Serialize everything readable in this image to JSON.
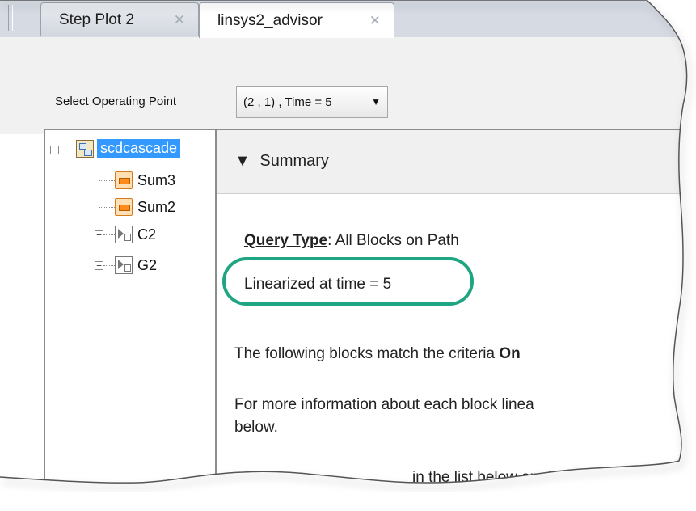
{
  "tabs": [
    {
      "label": "Step Plot 2",
      "close": "✕",
      "active": false
    },
    {
      "label": "linsys2_advisor",
      "close": "✕",
      "active": true
    }
  ],
  "operating_point": {
    "label": "Select Operating Point",
    "value": "(2 , 1) , Time = 5",
    "caret_icon": "triangle-down"
  },
  "tree": {
    "root": {
      "label": "scdcascade",
      "expander": "−",
      "icon": "model-icon"
    },
    "children": [
      {
        "label": "Sum3",
        "icon": "sum-block-icon"
      },
      {
        "label": "Sum2",
        "icon": "sum-block-icon"
      },
      {
        "label": "C2",
        "icon": "subsystem-icon",
        "expander": "+"
      },
      {
        "label": "G2",
        "icon": "subsystem-icon",
        "expander": "+"
      }
    ]
  },
  "summary": {
    "header_arrow": "▼",
    "header": "Summary",
    "query_type_label": "Query Type",
    "query_type_value": ": All Blocks on Path",
    "linearized": "Linearized at time = 5",
    "following_prefix": "The following blocks match the criteria ",
    "following_bold": "On",
    "info_line1": "For more information about each block linea",
    "info_line2": "below.",
    "cut_line": "in the list below are line"
  },
  "colors": {
    "highlight_oval": "#1fa582",
    "selection": "#3399ff"
  }
}
